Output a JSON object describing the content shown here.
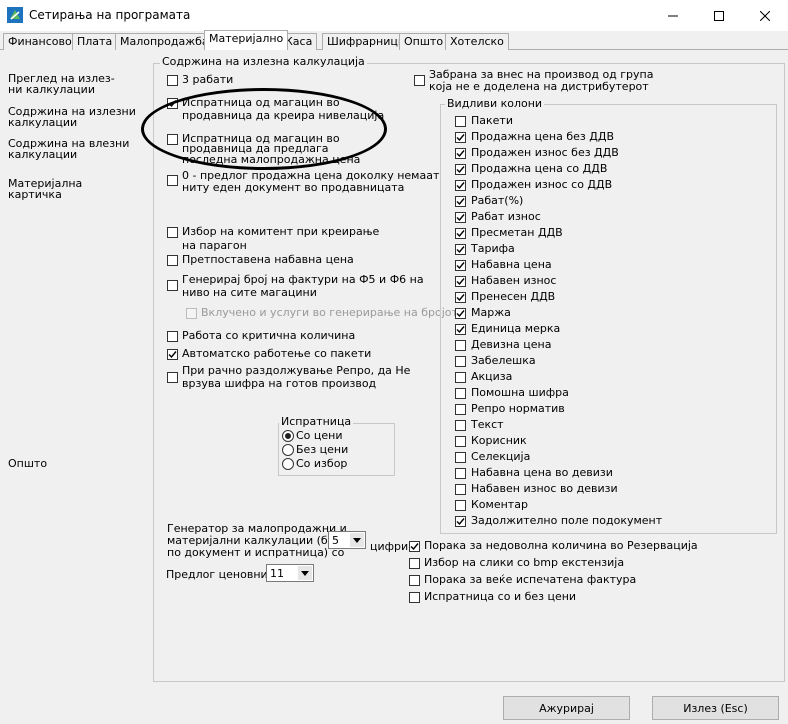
{
  "window": {
    "title": "Сетирања на програмата",
    "controls": {
      "minimize": "—",
      "maximize": "☐",
      "close": "✕"
    }
  },
  "tabs": [
    {
      "label": "Финансово",
      "active": false
    },
    {
      "label": "Плата",
      "active": false
    },
    {
      "label": "Малопродажба",
      "active": false
    },
    {
      "label": "Материјално",
      "active": true
    },
    {
      "label": "Каса",
      "active": false
    },
    {
      "label": "Шифрарници",
      "active": false
    },
    {
      "label": "Општо",
      "active": false
    },
    {
      "label": "Хотелско",
      "active": false
    }
  ],
  "left_nav": {
    "items": [
      {
        "line1": "Преглед на излез-",
        "line2": "ни калкулации"
      },
      {
        "line1": "Содржина на излезни",
        "line2": "калкулации"
      },
      {
        "line1": "Содржина на влезни",
        "line2": "калкулации"
      },
      {
        "line1": "Материјална картичка",
        "line2": ""
      }
    ],
    "general": "Општо"
  },
  "group_title": "Содржина на излезна калкулација",
  "options": [
    {
      "line1": "3 рабати",
      "line2": "",
      "checked": false
    },
    {
      "line1": "Испратница од магацин во",
      "line2": "продавница да креира нивелација",
      "checked": true
    },
    {
      "line1": "Испратница од магацин во",
      "line2": "продавница да предлага",
      "line3": "последна малопродажна цена",
      "checked": false
    },
    {
      "line1": "0 - предлог продажна цена доколку немаат",
      "line2": "ниту еден документ во продавницата",
      "checked": false
    },
    {
      "line1": "Избор на комитент при креирање",
      "line2": "на парагон",
      "checked": false
    },
    {
      "line1": "Претпоставена набавна цена",
      "line2": "",
      "checked": false
    },
    {
      "line1": "Генерирај број на фактури на Ф5 и Ф6 на",
      "line2": "ниво на сите магацини",
      "checked": false
    },
    {
      "line1": "Вклучено и услуги во генерирање на бројот",
      "line2": "",
      "checked": false,
      "disabled": true
    },
    {
      "line1": "Работа со критична количина",
      "line2": "",
      "checked": false
    },
    {
      "line1": "Автоматско работење со пакети",
      "line2": "",
      "checked": true
    },
    {
      "line1": "При рачно раздолжување Репро, да Не",
      "line2": "врзува шифра на готов производ",
      "checked": false
    }
  ],
  "restrict": {
    "line1": "Забрана за внес на производ од група",
    "line2": "која не е доделена на дистрибутерот",
    "checked": false
  },
  "columns_title": "Видливи колони",
  "columns": [
    {
      "label": "Пакети",
      "checked": false
    },
    {
      "label": "Продажна цена без ДДВ",
      "checked": true
    },
    {
      "label": "Продажен износ без ДДВ",
      "checked": true
    },
    {
      "label": "Продажна цена со ДДВ",
      "checked": true
    },
    {
      "label": "Продажен износ со ДДВ",
      "checked": true
    },
    {
      "label": "Рабат(%)",
      "checked": true
    },
    {
      "label": "Рабат износ",
      "checked": true
    },
    {
      "label": "Пресметан ДДВ",
      "checked": true
    },
    {
      "label": "Тарифа",
      "checked": true
    },
    {
      "label": "Набавна цена",
      "checked": true
    },
    {
      "label": "Набавен износ",
      "checked": true
    },
    {
      "label": "Пренесен ДДВ",
      "checked": true
    },
    {
      "label": "Маржа",
      "checked": true
    },
    {
      "label": "Единица мерка",
      "checked": true
    },
    {
      "label": "Девизна цена",
      "checked": false
    },
    {
      "label": "Забелешка",
      "checked": false
    },
    {
      "label": "Акциза",
      "checked": false
    },
    {
      "label": "Помошна шифра",
      "checked": false
    },
    {
      "label": "Репро норматив",
      "checked": false
    },
    {
      "label": "Текст",
      "checked": false
    },
    {
      "label": "Корисник",
      "checked": false
    },
    {
      "label": "Селекција",
      "checked": false
    },
    {
      "label": "Набавна цена во девизи",
      "checked": false
    },
    {
      "label": "Набавен износ  во девизи",
      "checked": false
    },
    {
      "label": "Коментар",
      "checked": false
    },
    {
      "label": "Задолжително поле подокумент",
      "checked": true
    }
  ],
  "shipment": {
    "title": "Испратница",
    "options": [
      {
        "label": "Со цени",
        "selected": true
      },
      {
        "label": "Без цени",
        "selected": false
      },
      {
        "label": "Со избор",
        "selected": false
      }
    ]
  },
  "generator": {
    "line1": "Генератор за малопродажни и",
    "line2": "материјални калкулации (број,",
    "line3": "по документ и испратница) со",
    "value": "5",
    "suffix": "цифри"
  },
  "price_list": {
    "label": "Предлог ценовник",
    "value": "11"
  },
  "bottom_options": [
    {
      "label": "Порака за недоволна количина во Резервација",
      "checked": true
    },
    {
      "label": "Избор на слики со bmp екстензија",
      "checked": false
    },
    {
      "label": "Порака за веќе испечатена фактура",
      "checked": false
    },
    {
      "label": "Испратница со и без цени",
      "checked": false
    }
  ],
  "buttons": {
    "update": "Ажурирај",
    "exit": "Излез (Esc)"
  },
  "colors": {
    "accent_tab": "#ffffff",
    "background": "#f0f0f0",
    "border": "#adadad"
  }
}
